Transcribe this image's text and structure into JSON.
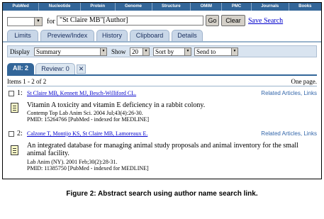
{
  "nav": {
    "items": [
      "PubMed",
      "Nucleotide",
      "Protein",
      "Genome",
      "Structure",
      "OMIM",
      "PMC",
      "Journals",
      "Books"
    ]
  },
  "search": {
    "for_label": "for",
    "query": "\"St Claire MB\"[Author]",
    "go_label": "Go",
    "clear_label": "Clear",
    "save_label": "Save Search"
  },
  "tabs": [
    "Limits",
    "Preview/Index",
    "History",
    "Clipboard",
    "Details"
  ],
  "display_bar": {
    "display_label": "Display",
    "format_value": "Summary",
    "show_label": "Show",
    "show_value": "20",
    "sort_value": "Sort by",
    "send_value": "Send to"
  },
  "results_tabs": {
    "all_label": "All: 2",
    "review_label": "Review: 0",
    "icon": "wrench-icon"
  },
  "items_count": "Items 1 - 2 of 2",
  "page_info": "One page.",
  "results": [
    {
      "number": "1:",
      "authors": "St Claire MB, Kennett MJ, Besch-Williford CL.",
      "related": "Related Articles, Links",
      "title": "Vitamin A toxicity and vitamin E deficiency in a rabbit colony.",
      "citation": "Contemp Top Lab Anim Sci. 2004 Jul;43(4):26-30.",
      "pmid": "PMID: 15264766 [PubMed - indexed for MEDLINE]"
    },
    {
      "number": "2:",
      "authors": "Calzone T, Montijo KS, St Claire MB, Lamoreaux E.",
      "related": "Related Articles, Links",
      "title": "An integrated database for managing animal study proposals and animal inventory for the small animal facility.",
      "citation": "Lab Anim (NY). 2001 Feb;30(2):28-31.",
      "pmid": "PMID: 11385750 [PubMed - indexed for MEDLINE]"
    }
  ],
  "caption": "Figure 2:   Abstract search using author name search link."
}
